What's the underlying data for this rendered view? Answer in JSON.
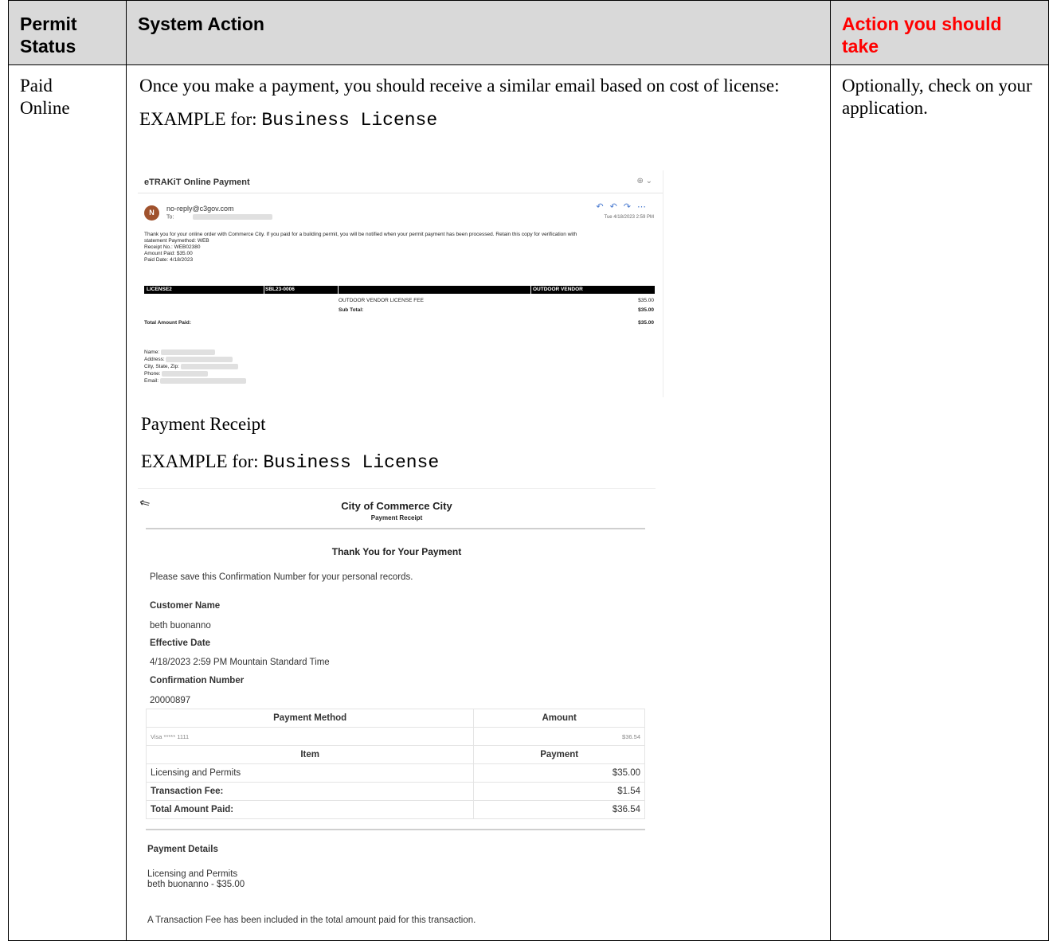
{
  "headers": {
    "permit_status": "Permit Status",
    "system_action": "System Action",
    "action_you_should_take": "Action you should take"
  },
  "row": {
    "status": "Paid Online",
    "action_intro": "Once you make a payment, you should receive a similar email based on cost of license:",
    "example_prefix": "EXAMPLE for: ",
    "example_value": "Business License",
    "receipt_caption": "Payment Receipt",
    "user_action": "Optionally, check on your application."
  },
  "email": {
    "subject": "eTRAKiT Online Payment",
    "zoom_icon": "zoom-icon",
    "avatar_letter": "N",
    "from": "no-reply@c3gov.com",
    "to_label": "To:",
    "date": "Tue 4/18/2023 2:59 PM",
    "body_line1": "Thank you for your online order with Commerce City.  If you paid for a building permit, you will be notified when your permit payment has been processed. Retain this copy for verification with",
    "body_line2": "statement Paymethod: WEB",
    "receipt_no": "Receipt No.: WEB02380",
    "amount_paid": "Amount Paid: $35.00",
    "paid_date": "Paid Date: 4/18/2023",
    "bar_col1": "LICENSE2",
    "bar_col2": "SBL23-0006",
    "bar_col3": "OUTDOOR VENDOR",
    "fee_label": "OUTDOOR VENDOR LICENSE FEE",
    "fee_amount": "$35.00",
    "subtotal_label": "Sub Total:",
    "subtotal_amount": "$35.00",
    "total_label": "Total Amount Paid:",
    "total_amount": "$35.00",
    "name_label": "Name:",
    "address_label": "Address:",
    "csz_label": "City, State, Zip:",
    "phone_label": "Phone:",
    "email_label": "Email:"
  },
  "receipt": {
    "org": "City of Commerce City",
    "subtitle": "Payment Receipt",
    "thanks": "Thank You for Your Payment",
    "save_note": "Please save this Confirmation Number for your personal records.",
    "customer_name_label": "Customer Name",
    "customer_name": "beth buonanno",
    "effective_date_label": "Effective Date",
    "effective_date": "4/18/2023 2:59 PM Mountain Standard Time",
    "confirmation_label": "Confirmation Number",
    "confirmation_number": "20000897",
    "pm_header": "Payment Method",
    "amount_header": "Amount",
    "pm_value": "Visa ***** 1111",
    "pm_amount": "$36.54",
    "item_header": "Item",
    "payment_header": "Payment",
    "items": [
      {
        "label": "Licensing and Permits",
        "amount": "$35.00"
      },
      {
        "label": "Transaction Fee:",
        "amount": "$1.54"
      },
      {
        "label": "Total Amount Paid:",
        "amount": "$36.54"
      }
    ],
    "details_label": "Payment Details",
    "details_line1": "Licensing and Permits",
    "details_line2": "beth buonanno - $35.00",
    "fee_note": "A Transaction Fee has been included in the total amount paid for this transaction."
  }
}
